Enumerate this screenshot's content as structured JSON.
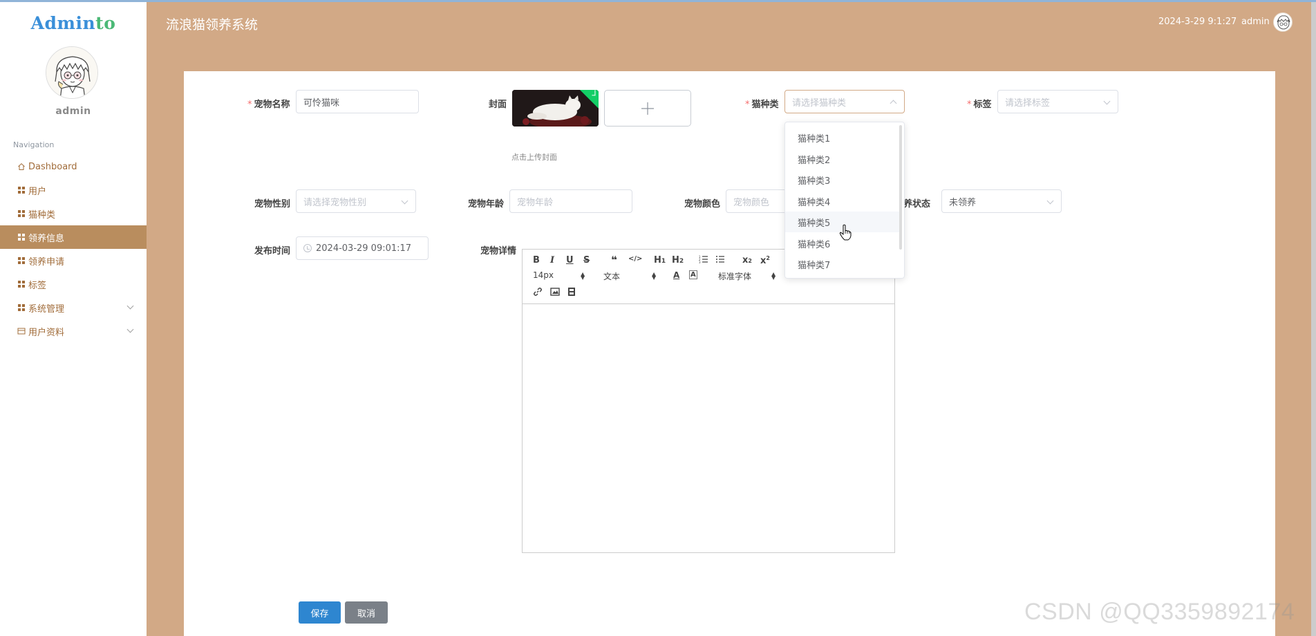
{
  "sidebar": {
    "logo_main": "Admin",
    "logo_accent": "to",
    "username": "admin",
    "nav_title": "Navigation",
    "items": [
      {
        "label": "Dashboard",
        "icon": "home-icon"
      },
      {
        "label": "用户",
        "icon": "grid-icon"
      },
      {
        "label": "猫种类",
        "icon": "grid-icon"
      },
      {
        "label": "领养信息",
        "icon": "grid-icon",
        "active": true
      },
      {
        "label": "领养申请",
        "icon": "grid-icon"
      },
      {
        "label": "标签",
        "icon": "grid-icon"
      },
      {
        "label": "系统管理",
        "icon": "grid-icon",
        "expandable": true
      },
      {
        "label": "用户资料",
        "icon": "card-icon",
        "expandable": true
      }
    ]
  },
  "header": {
    "app_title": "流浪猫领养系统",
    "datetime": "2024-3-29 9:1:27",
    "user": "admin"
  },
  "form": {
    "pet_name": {
      "label": "宠物名称",
      "value": "可怜猫咪"
    },
    "cover": {
      "label": "封面",
      "tip": "点击上传封面"
    },
    "cat_type": {
      "label": "猫种类",
      "placeholder": "请选择猫种类"
    },
    "tag": {
      "label": "标签",
      "placeholder": "请选择标签"
    },
    "gender": {
      "label": "宠物性别",
      "placeholder": "请选择宠物性别"
    },
    "age": {
      "label": "宠物年龄",
      "placeholder": "宠物年龄"
    },
    "color": {
      "label": "宠物颜色",
      "placeholder": "宠物颜色"
    },
    "status": {
      "label": "领养状态",
      "value": "未领养"
    },
    "publish_time": {
      "label": "发布时间",
      "value": "2024-03-29 09:01:17"
    },
    "detail": {
      "label": "宠物详情"
    },
    "save_label": "保存",
    "cancel_label": "取消"
  },
  "editor": {
    "font_size": "14px",
    "format": "文本",
    "font_family": "标准字体"
  },
  "cat_type_dropdown": {
    "options": [
      "猫种类1",
      "猫种类2",
      "猫种类3",
      "猫种类4",
      "猫种类5",
      "猫种类6",
      "猫种类7"
    ],
    "hovered_index": 4
  },
  "watermark": "CSDN @QQ3359892174",
  "colors": {
    "header_bg": "#d2a986",
    "active_nav": "#b98d5e",
    "nav_text": "#a16c3a",
    "save_button": "#2e86d0",
    "cancel_button": "#7a8088"
  }
}
